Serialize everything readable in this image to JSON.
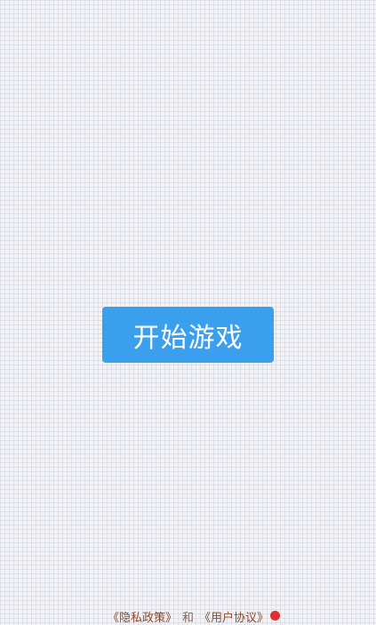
{
  "main": {
    "start_button_label": "开始游戏"
  },
  "footer": {
    "privacy_link": "《隐私政策》",
    "separator": "和",
    "terms_link": "《用户协议》"
  },
  "colors": {
    "primary_button": "#3a9fed",
    "link_text": "#8a4a2f",
    "notification_dot": "#e02f2f"
  }
}
